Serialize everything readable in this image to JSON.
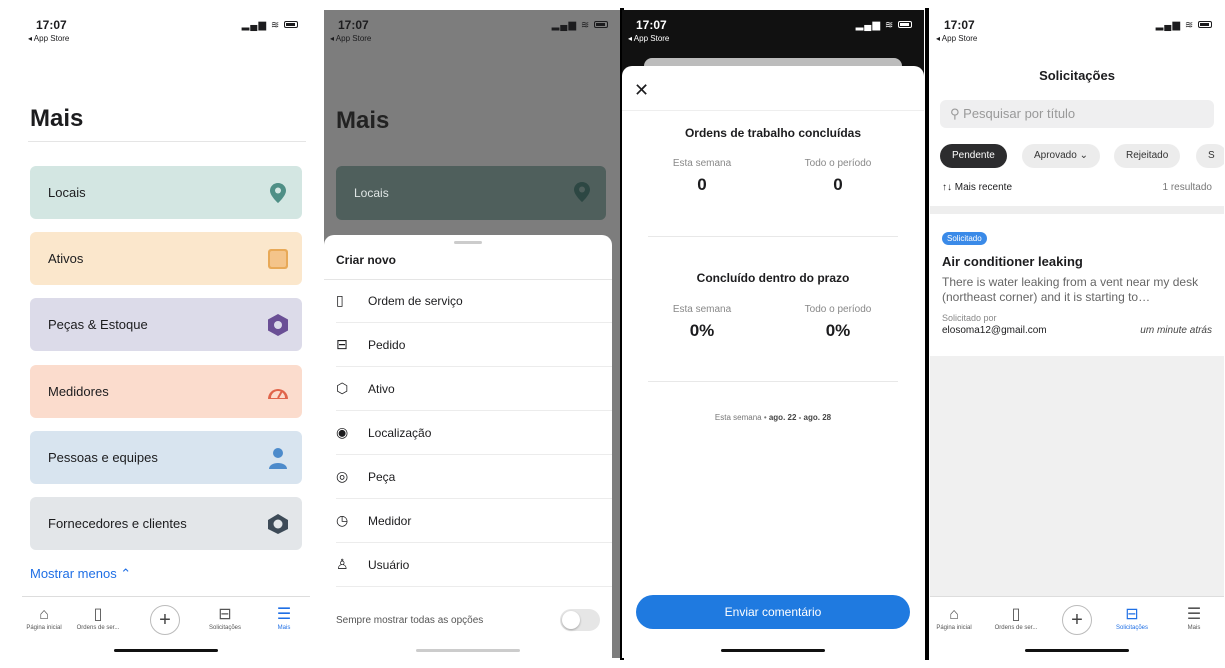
{
  "status": {
    "time": "17:07",
    "back": "◂ App Store"
  },
  "screen1": {
    "title": "Mais",
    "cards": [
      {
        "label": "Locais",
        "icon": "map-pin-icon",
        "bg": "#d3e6e2",
        "icon_color": "#4f8f86"
      },
      {
        "label": "Ativos",
        "icon": "asset-box-icon",
        "bg": "#fbe7cc",
        "icon_color": "#e8a957"
      },
      {
        "label": "Peças & Estoque",
        "icon": "hexagon-part-icon",
        "bg": "#dcdbe9",
        "icon_color": "#6a4f95"
      },
      {
        "label": "Medidores",
        "icon": "gauge-icon",
        "bg": "#fbdccd",
        "icon_color": "#e0644a"
      },
      {
        "label": "Pessoas e equipes",
        "icon": "person-icon",
        "bg": "#d8e4ef",
        "icon_color": "#4d8bcb"
      },
      {
        "label": "Fornecedores e clientes",
        "icon": "vendor-icon",
        "bg": "#e3e6e9",
        "icon_color": "#3d4a57"
      }
    ],
    "show_less": "Mostrar menos ⌃",
    "tabs": [
      {
        "label": "Página inicial",
        "icon": "home-icon"
      },
      {
        "label": "Ordens de ser...",
        "icon": "clipboard-icon"
      },
      {
        "label": "Solicitações",
        "icon": "inbox-icon"
      },
      {
        "label": "Mais",
        "icon": "menu-icon"
      }
    ]
  },
  "screen2": {
    "title": "Mais",
    "card_label": "Locais",
    "sheet_title": "Criar novo",
    "options": [
      {
        "label": "Ordem de serviço",
        "icon": "clipboard-icon"
      },
      {
        "label": "Pedido",
        "icon": "inbox-icon"
      },
      {
        "label": "Ativo",
        "icon": "cube-icon"
      },
      {
        "label": "Localização",
        "icon": "map-pin-icon"
      },
      {
        "label": "Peça",
        "icon": "gear-part-icon"
      },
      {
        "label": "Medidor",
        "icon": "gauge-icon"
      },
      {
        "label": "Usuário",
        "icon": "user-icon"
      }
    ],
    "always_show": "Sempre mostrar todas as opções"
  },
  "screen3": {
    "section1_title": "Ordens de trabalho concluídas",
    "section2_title": "Concluído dentro do prazo",
    "week_label": "Esta semana",
    "all_label": "Todo o período",
    "s1_week": "0",
    "s1_all": "0",
    "s2_week": "0%",
    "s2_all": "0%",
    "range_prefix": "Esta semana • ",
    "range_value": "ago. 22 - ago. 28",
    "send_button": "Enviar comentário"
  },
  "screen4": {
    "title": "Solicitações",
    "search_placeholder": "Pesquisar por título",
    "filters": [
      "Pendente",
      "Aprovado ⌄",
      "Rejeitado",
      "S"
    ],
    "sort": "↑↓ Mais recente",
    "count": "1 resultado",
    "request": {
      "badge": "Solicitado",
      "title": "Air conditioner leaking",
      "desc": "There is water leaking from a vent near my desk (northeast corner) and it is starting to…",
      "by_label": "Solicitado por",
      "by": "elosoma12@gmail.com",
      "when": "um minute atrás"
    }
  },
  "colors": {
    "accent": "#1f6fe5",
    "button": "#1f7ae0",
    "badge": "#3a8ae8"
  }
}
